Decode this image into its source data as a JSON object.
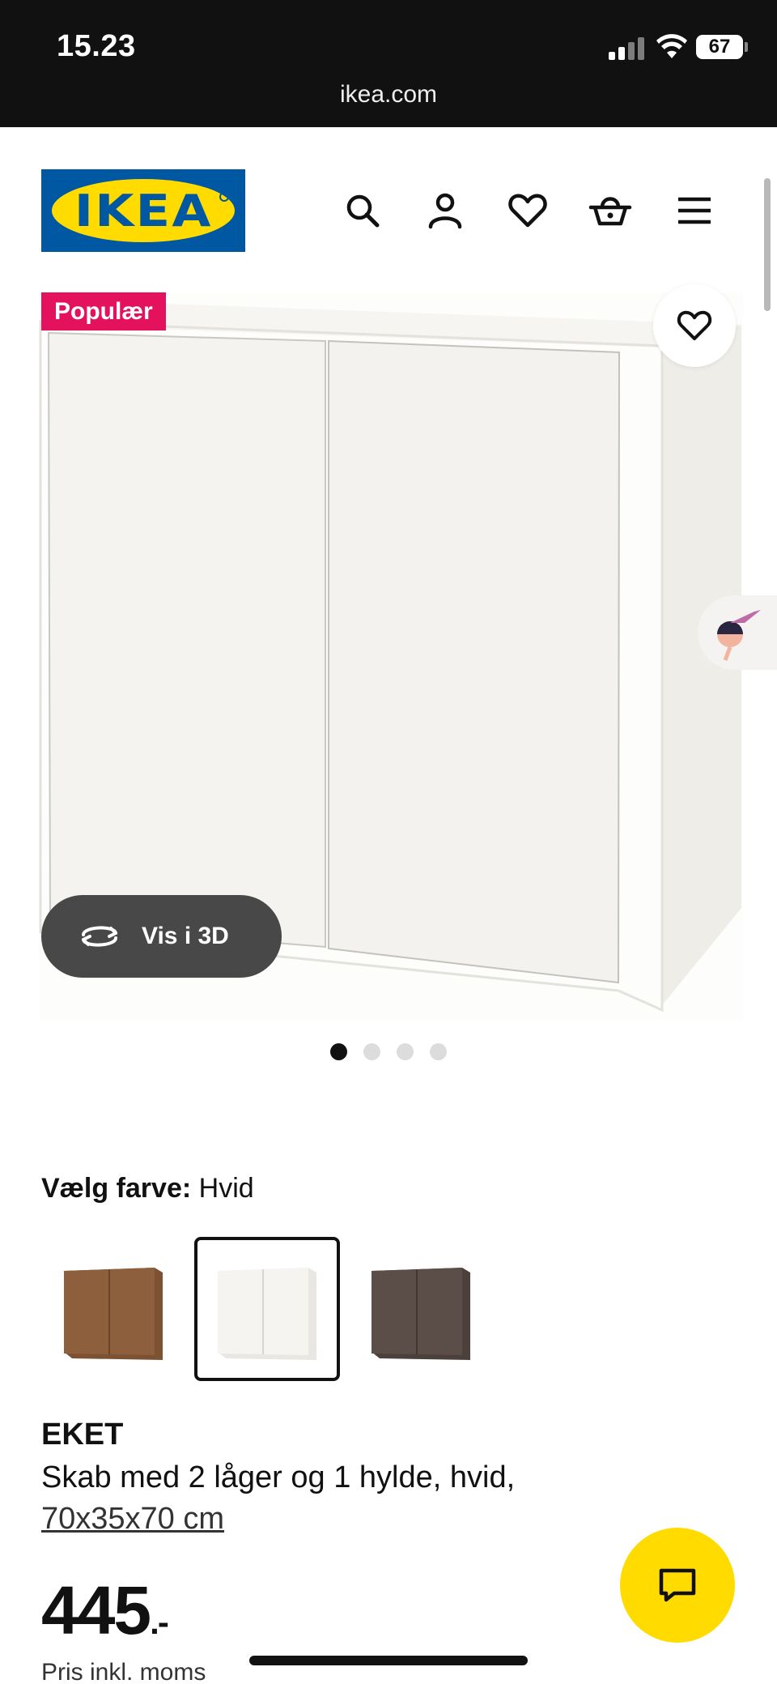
{
  "status_bar": {
    "time": "15.23",
    "url": "ikea.com",
    "battery": "67"
  },
  "header": {
    "logo_text": "IKEA",
    "icons": [
      "search-icon",
      "account-icon",
      "heart-icon",
      "basket-icon",
      "menu-icon"
    ]
  },
  "product_image": {
    "badge": "Populær",
    "vis3d_label": "Vis i 3D",
    "gallery_count": 4,
    "gallery_active_index": 0
  },
  "color": {
    "label": "Vælg farve:",
    "value": "Hvid",
    "swatches": [
      {
        "name": "walnut",
        "color": "#8a5a36",
        "selected": false
      },
      {
        "name": "white",
        "color": "#f3f2ee",
        "selected": true
      },
      {
        "name": "dark-brown",
        "color": "#5a4c47",
        "selected": false
      }
    ]
  },
  "product": {
    "name": "EKET",
    "description": "Skab med 2 låger og 1 hylde, hvid,",
    "size": "70x35x70 cm",
    "price_main": "445",
    "price_suffix": ".-",
    "vat_note": "Pris inkl. moms"
  },
  "colors": {
    "badge": "#e4125d",
    "ikea_blue": "#0058a3",
    "ikea_yellow": "#ffdb00"
  }
}
